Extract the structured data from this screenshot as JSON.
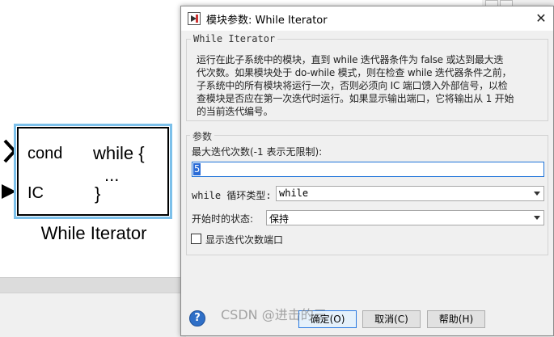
{
  "block": {
    "port_cond": "cond",
    "port_ic": "IC",
    "icon_while": "while {",
    "icon_dots": "...",
    "icon_close": "}",
    "name": "While Iterator"
  },
  "dialog": {
    "title": "模块参数: While Iterator",
    "close_glyph": "✕",
    "description_group": "While Iterator",
    "description_lines": [
      "运行在此子系统中的模块，直到 while 迭代器条件为 false 或达到最大迭",
      "代次数。如果模块处于 do-while 模式，则在检查 while 迭代器条件之前，",
      "子系统中的所有模块将运行一次，否则必须向 IC 端口馈入外部信号，以检",
      "查模块是否应在第一次迭代时运行。如果显示输出端口，它将输出从 1 开始",
      "的当前迭代编号。"
    ],
    "params_group": "参数",
    "max_iter_label": "最大迭代次数(-1 表示无限制):",
    "max_iter_value": "5",
    "loop_type_label": "while 循环类型:",
    "loop_type_value": "while",
    "start_state_label": "开始时的状态:",
    "start_state_value": "保持",
    "show_iter_port_label": "显示迭代次数端口",
    "show_iter_port_checked": false,
    "ok_label": "确定(O)",
    "cancel_label": "取消(C)",
    "help_label": "帮助(H)",
    "help_glyph": "?"
  },
  "watermark": "CSDN @进击的三",
  "colors": {
    "selection_border": "#7cc0ea",
    "input_focus": "#1f74d9",
    "selected_text_bg": "#2a6bd6"
  }
}
